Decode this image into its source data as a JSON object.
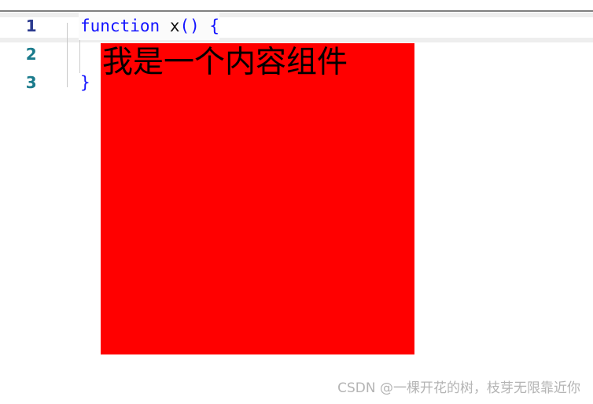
{
  "editor": {
    "line_numbers": [
      "1",
      "2",
      "3"
    ],
    "code": {
      "line1": {
        "keyword": "function",
        "space": " ",
        "identifier": "x",
        "parens": "()",
        "space2": " ",
        "open_brace": "{"
      },
      "line3": {
        "close_brace": "}"
      }
    }
  },
  "component": {
    "label": "我是一个内容组件",
    "background_color": "#ff0000",
    "text_color": "#000000"
  },
  "watermark": {
    "text": "CSDN @一棵开花的树，枝芽无限靠近你",
    "color": "#b4b4b4"
  },
  "colors": {
    "keyword": "#1414ff",
    "identifier": "#111111",
    "line_number_active": "#2b3a8f",
    "line_number": "#1b7b8c",
    "rule": "#808080",
    "row_stripe": "#eeeeee"
  }
}
